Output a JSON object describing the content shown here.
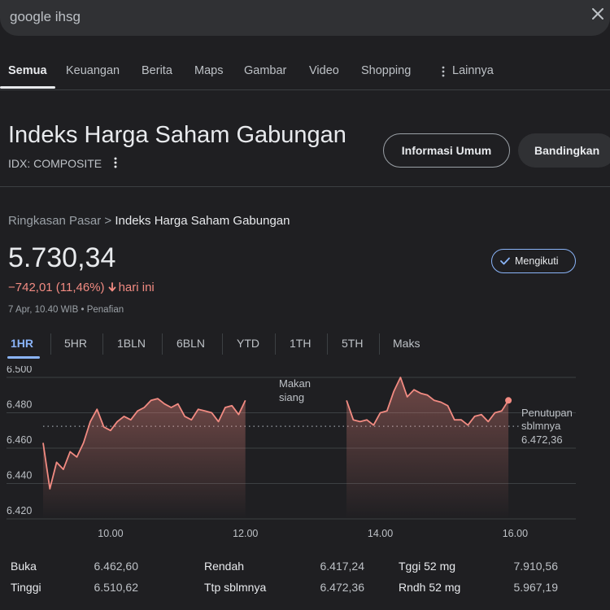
{
  "search": {
    "query": "google ihsg"
  },
  "tabs": [
    {
      "label": "Semua",
      "active": true
    },
    {
      "label": "Keuangan"
    },
    {
      "label": "Berita"
    },
    {
      "label": "Maps"
    },
    {
      "label": "Gambar"
    },
    {
      "label": "Video"
    },
    {
      "label": "Shopping"
    },
    {
      "label": "Lainnya"
    }
  ],
  "header": {
    "title": "Indeks Harga Saham Gabungan",
    "ticker": "IDX: COMPOSITE",
    "info_button": "Informasi Umum",
    "compare_button": "Bandingkan"
  },
  "summary": {
    "breadcrumb_parent": "Ringkasan Pasar",
    "breadcrumb_sep": ">",
    "breadcrumb_current": "Indeks Harga Saham Gabungan",
    "price": "5.730,34",
    "change": "−742,01 (11,46%)",
    "change_suffix": "hari ini",
    "timestamp": "7 Apr, 10.40 WIB • Penafian",
    "follow_button": "Mengikuti"
  },
  "ranges": [
    {
      "label": "1HR",
      "active": true
    },
    {
      "label": "5HR"
    },
    {
      "label": "1BLN"
    },
    {
      "label": "6BLN"
    },
    {
      "label": "YTD"
    },
    {
      "label": "1TH"
    },
    {
      "label": "5TH"
    },
    {
      "label": "Maks"
    }
  ],
  "chart_data": {
    "type": "line",
    "xlabel": "",
    "ylabel": "",
    "ylim": [
      6.42,
      6.5
    ],
    "xlim": [
      9.0,
      16.9
    ],
    "y_ticks": [
      "6.500",
      "6.480",
      "6.460",
      "6.440",
      "6.420"
    ],
    "x_ticks": [
      "10.00",
      "12.00",
      "14.00",
      "16.00"
    ],
    "lunch_label_1": "Makan",
    "lunch_label_2": "siang",
    "prev_close": 6472.36,
    "prev_close_label_1": "Penutupan",
    "prev_close_label_2": "sblmnya",
    "prev_close_value": "6.472,36",
    "line_color": "#f28b82",
    "grid": true,
    "series": [
      {
        "x": [
          9.0,
          9.1,
          9.2,
          9.3,
          9.4,
          9.5,
          9.6,
          9.7,
          9.8,
          9.9,
          10.0,
          10.1,
          10.2,
          10.3,
          10.4,
          10.5,
          10.6,
          10.7,
          10.8,
          10.9,
          11.0,
          11.1,
          11.2,
          11.3,
          11.4,
          11.5,
          11.6,
          11.7,
          11.8,
          11.9,
          12.0
        ],
        "y": [
          6463.0,
          6437.0,
          6452.0,
          6448.0,
          6458.0,
          6455.0,
          6463.0,
          6475.0,
          6482.0,
          6472.0,
          6470.0,
          6475.0,
          6478.0,
          6476.0,
          6481.0,
          6483.0,
          6487.0,
          6488.0,
          6485.0,
          6483.0,
          6485.0,
          6478.0,
          6476.0,
          6482.0,
          6481.0,
          6480.0,
          6475.0,
          6483.0,
          6484.0,
          6479.0,
          6487.0
        ]
      },
      {
        "x": [
          13.5,
          13.6,
          13.7,
          13.8,
          13.9,
          14.0,
          14.1,
          14.2,
          14.3,
          14.4,
          14.5,
          14.6,
          14.7,
          14.8,
          14.9,
          15.0,
          15.1,
          15.2,
          15.3,
          15.4,
          15.5,
          15.6,
          15.7,
          15.8,
          15.9
        ],
        "y": [
          6487.0,
          6476.0,
          6475.0,
          6476.0,
          6473.0,
          6480.0,
          6481.0,
          6492.0,
          6500.0,
          6489.0,
          6493.0,
          6491.0,
          6490.0,
          6487.0,
          6486.0,
          6484.0,
          6476.0,
          6476.0,
          6473.0,
          6478.0,
          6479.0,
          6475.0,
          6480.0,
          6481.0,
          6487.0
        ]
      }
    ]
  },
  "stats": [
    {
      "label": "Buka",
      "value": "6.462,60"
    },
    {
      "label": "Tinggi",
      "value": "6.510,62"
    },
    {
      "label": "Rendah",
      "value": "6.417,24"
    },
    {
      "label": "Ttp sblmnya",
      "value": "6.472,36"
    },
    {
      "label": "Tggi 52 mg",
      "value": "7.910,56"
    },
    {
      "label": "Rndh 52 mg",
      "value": "5.967,19"
    }
  ]
}
